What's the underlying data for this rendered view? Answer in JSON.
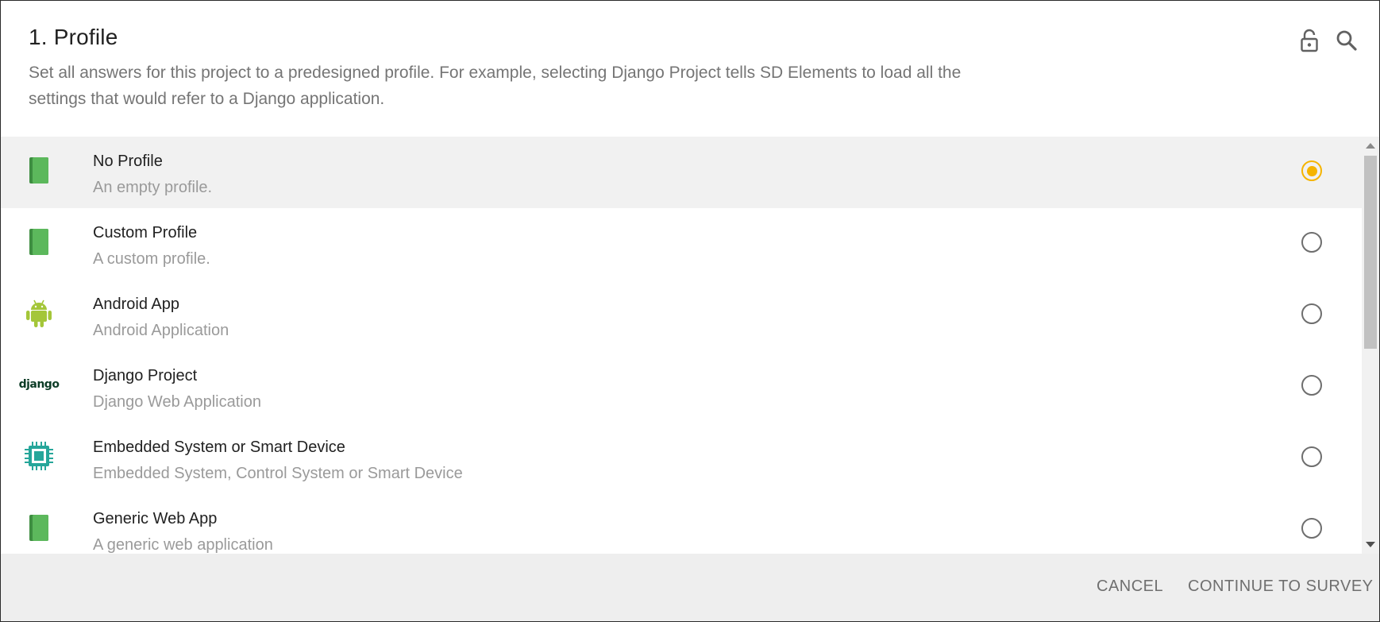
{
  "header": {
    "title": "1. Profile",
    "description": "Set all answers for this project to a predesigned profile. For example, selecting Django Project tells SD Elements to load all the settings that would refer to a Django application.",
    "icons": [
      "lock-open-icon",
      "search-icon"
    ]
  },
  "profiles": [
    {
      "title": "No Profile",
      "subtitle": "An empty profile.",
      "icon": "book-icon",
      "selected": true
    },
    {
      "title": "Custom Profile",
      "subtitle": "A custom profile.",
      "icon": "book-icon",
      "selected": false
    },
    {
      "title": "Android App",
      "subtitle": "Android Application",
      "icon": "android-icon",
      "selected": false
    },
    {
      "title": "Django Project",
      "subtitle": "Django Web Application",
      "icon": "django-logo-icon",
      "icon_text": "django",
      "selected": false
    },
    {
      "title": "Embedded System or Smart Device",
      "subtitle": "Embedded System, Control System or Smart Device",
      "icon": "chip-icon",
      "selected": false
    },
    {
      "title": "Generic Web App",
      "subtitle": "A generic web application",
      "icon": "book-icon",
      "selected": false
    }
  ],
  "footer": {
    "cancel_label": "CANCEL",
    "continue_label": "CONTINUE TO SURVEY"
  },
  "colors": {
    "accent": "#f5b400",
    "book_green": "#5cb85c",
    "android_green": "#a4c639",
    "chip_teal": "#26a69a",
    "django_green": "#0c3c26"
  }
}
